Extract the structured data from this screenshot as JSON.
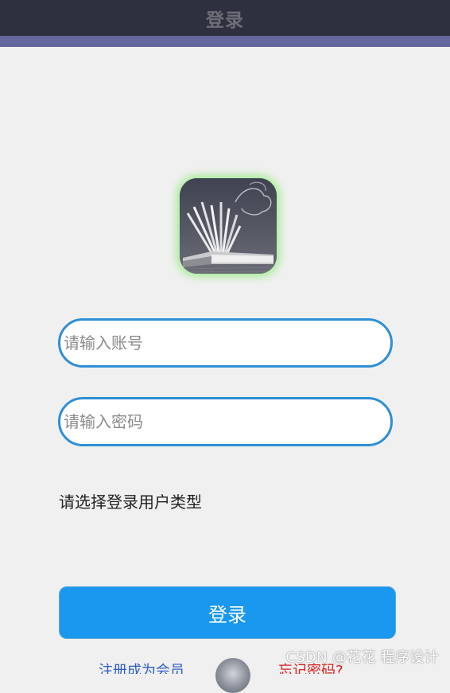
{
  "header": {
    "title": "登录"
  },
  "logo": {
    "icon": "open-book-icon"
  },
  "form": {
    "account_placeholder": "请输入账号",
    "account_value": "",
    "password_placeholder": "请输入密码",
    "password_value": "",
    "user_type_label": "请选择登录用户类型",
    "login_label": "登录"
  },
  "footer": {
    "left_link": "注册成为会员",
    "right_link": "忘记密码?"
  },
  "watermark": {
    "text": "CSDN @花花 程序设计"
  },
  "colors": {
    "topbar": "#2f303f",
    "accent_bar": "#64679b",
    "background": "#f0f0f0",
    "input_border": "#2e8fd6",
    "button": "#1a97ee",
    "logo_glow": "#8ceb78"
  }
}
